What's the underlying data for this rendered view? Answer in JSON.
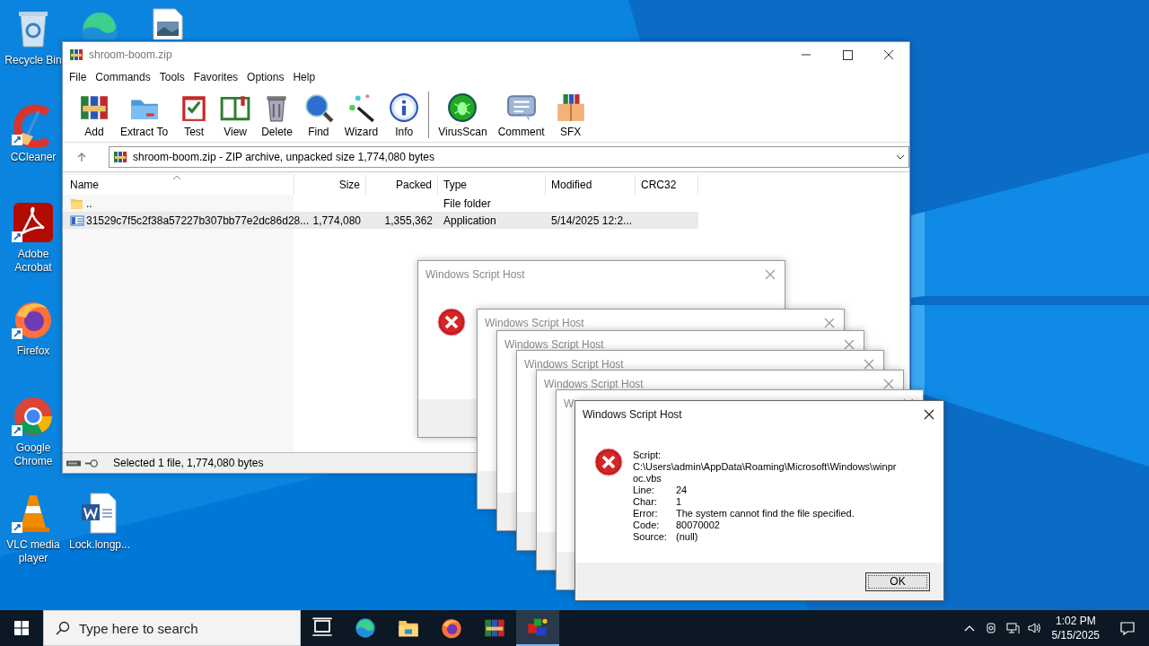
{
  "desktop_icons": [
    {
      "label": "Recycle Bin"
    },
    {
      "label": "CCleaner"
    },
    {
      "label": "Adobe Acrobat"
    },
    {
      "label": "Firefox"
    },
    {
      "label": "Google Chrome"
    },
    {
      "label": "VLC media player"
    },
    {
      "label": "Lock.longp..."
    }
  ],
  "archiver": {
    "title": "shroom-boom.zip",
    "menu": [
      "File",
      "Commands",
      "Tools",
      "Favorites",
      "Options",
      "Help"
    ],
    "toolbar": [
      {
        "label": "Add"
      },
      {
        "label": "Extract To"
      },
      {
        "label": "Test"
      },
      {
        "label": "View"
      },
      {
        "label": "Delete"
      },
      {
        "label": "Find"
      },
      {
        "label": "Wizard"
      },
      {
        "label": "Info"
      },
      {
        "label": "VirusScan"
      },
      {
        "label": "Comment"
      },
      {
        "label": "SFX"
      }
    ],
    "address": "shroom-boom.zip - ZIP archive, unpacked size 1,774,080 bytes",
    "columns": [
      "Name",
      "Size",
      "Packed",
      "Type",
      "Modified",
      "CRC32"
    ],
    "rows": [
      {
        "kind": "folder",
        "name": "..",
        "type": "File folder",
        "selected": false
      },
      {
        "kind": "application",
        "name": "31529c7f5c2f38a57227b307bb77e2dc86d28...",
        "size": "1,774,080",
        "packed": "1,355,362",
        "type": "Application",
        "modified": "5/14/2025 12:2...",
        "selected": true
      }
    ],
    "status": "Selected 1 file, 1,774,080 bytes"
  },
  "background_dialogs": [
    {
      "title": "Windows Script Host"
    },
    {
      "title": "Windows Script Host"
    },
    {
      "title": "Windows Script Host"
    },
    {
      "title": "Windows Script Host"
    },
    {
      "title": "Windows Script Host"
    },
    {
      "title": "W"
    }
  ],
  "dialog": {
    "title": "Windows Script Host",
    "script_label": "Script:",
    "script_path": "C:\\Users\\admin\\AppData\\Roaming\\Microsoft\\Windows\\winproc.vbs",
    "fields": [
      {
        "label": "Line:",
        "value": "24"
      },
      {
        "label": "Char:",
        "value": "1"
      },
      {
        "label": "Error:",
        "value": "The system cannot find the file specified."
      },
      {
        "label": "Code:",
        "value": "80070002"
      },
      {
        "label": "Source:",
        "value": "(null)"
      }
    ],
    "button": "OK"
  },
  "taskbar": {
    "search_placeholder": "Type here to search",
    "apps": [
      {
        "active": false
      },
      {
        "active": false
      },
      {
        "active": false
      },
      {
        "active": false
      },
      {
        "active": false
      },
      {
        "active": true
      }
    ],
    "time": "1:02 PM",
    "date": "5/15/2025"
  }
}
